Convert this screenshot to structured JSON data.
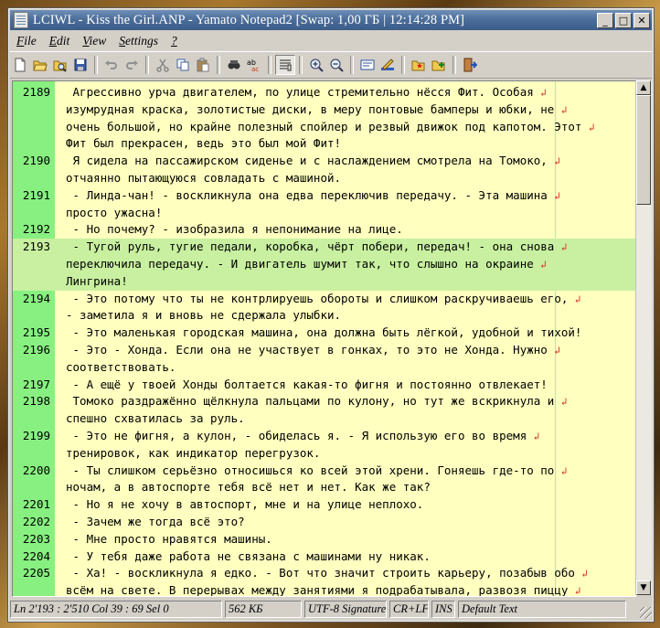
{
  "window": {
    "title": "LCIWL - Kiss the Girl.ANP - Yamato Notepad2 [Swap: 1,00 ГБ | 12:14:28 PM]",
    "buttons": [
      "_",
      "□",
      "✕"
    ]
  },
  "menu": [
    {
      "label": "File",
      "hotkey": "F"
    },
    {
      "label": "Edit",
      "hotkey": "E"
    },
    {
      "label": "View",
      "hotkey": "V"
    },
    {
      "label": "Settings",
      "hotkey": "S"
    },
    {
      "label": "?",
      "hotkey": "?"
    }
  ],
  "toolbar": {
    "icons": [
      "new-icon",
      "open-icon",
      "browse-icon",
      "save-icon",
      "undo-icon",
      "redo-icon",
      "cut-icon",
      "copy-icon",
      "paste-icon",
      "find-icon",
      "replace-icon",
      "word-wrap-icon",
      "zoom-in-icon",
      "zoom-out-icon",
      "scheme-icon",
      "customize-icon",
      "favorites-open-icon",
      "favorites-add-icon",
      "exit-icon"
    ]
  },
  "editor": {
    "colors": {
      "background": "#ffffc0",
      "gutter": "#88f080",
      "highlight": "#c8f0a0",
      "wrap_mark": "#d03020"
    },
    "wrap_mark": "↲",
    "lines": [
      {
        "num": "2189",
        "text": " Агрессивно урча двигателем, по улице стремительно нёсся Фит. Особая",
        "wrap": true
      },
      {
        "num": "",
        "text": "изумрудная краска, золотистые диски, в меру понтовые бамперы и юбки, не",
        "wrap": true
      },
      {
        "num": "",
        "text": "очень большой, но крайне полезный спойлер и резвый движок под капотом. Этот",
        "wrap": true
      },
      {
        "num": "",
        "text": "Фит был прекрасен, ведь это был мой Фит!",
        "wrap": false
      },
      {
        "num": "2190",
        "text": " Я сидела на пассажирском сиденье и с наслаждением смотрела на Томоко,",
        "wrap": true
      },
      {
        "num": "",
        "text": "отчаянно пытающуюся совладать с машиной.",
        "wrap": false
      },
      {
        "num": "2191",
        "text": " - Линда-чан! - воскликнула она едва переключив передачу. - Эта машина",
        "wrap": true
      },
      {
        "num": "",
        "text": "просто ужасна!",
        "wrap": false
      },
      {
        "num": "2192",
        "text": " - Но почему? - изобразила я непонимание на лице.",
        "wrap": false
      },
      {
        "num": "2193",
        "text": " - Тугой руль, тугие педали, коробка, чёрт побери, передач! - она снова",
        "wrap": true,
        "hl": true
      },
      {
        "num": "",
        "text": "переключила передачу. - И двигатель шумит так, что слышно на окраине",
        "wrap": true,
        "hl": true
      },
      {
        "num": "",
        "text": "Лингрина!",
        "wrap": false,
        "hl": true
      },
      {
        "num": "2194",
        "text": " - Это потому что ты не контрлируешь обороты и слишком раскручиваешь его,",
        "wrap": true
      },
      {
        "num": "",
        "text": "- заметила я и вновь не сдержала улыбки.",
        "wrap": false
      },
      {
        "num": "2195",
        "text": " - Это маленькая городская машина, она должна быть лёгкой, удобной и тихой!",
        "wrap": false
      },
      {
        "num": "2196",
        "text": " - Это - Хонда. Если она не участвует в гонках, то это не Хонда. Нужно",
        "wrap": true
      },
      {
        "num": "",
        "text": "соответствовать.",
        "wrap": false
      },
      {
        "num": "2197",
        "text": " - А ещё у твоей Хонды болтается какая-то фигня и постоянно отвлекает!",
        "wrap": false
      },
      {
        "num": "2198",
        "text": " Томоко раздражённо щёлкнула пальцами по кулону, но тут же вскрикнула и",
        "wrap": true
      },
      {
        "num": "",
        "text": "спешно схватилась за руль.",
        "wrap": false
      },
      {
        "num": "2199",
        "text": " - Это не фигня, а кулон, - обиделась я. - Я использую его во время",
        "wrap": true
      },
      {
        "num": "",
        "text": "тренировок, как индикатор перегрузок.",
        "wrap": false
      },
      {
        "num": "2200",
        "text": " - Ты слишком серьёзно относишься ко всей этой хрени. Гоняешь где-то по",
        "wrap": true
      },
      {
        "num": "",
        "text": "ночам, а в автоспорте тебя всё нет и нет. Как же так?",
        "wrap": false
      },
      {
        "num": "2201",
        "text": " - Но я не хочу в автоспорт, мне и на улице неплохо.",
        "wrap": false
      },
      {
        "num": "2202",
        "text": " - Зачем же тогда всё это?",
        "wrap": false
      },
      {
        "num": "2203",
        "text": " - Мне просто нравятся машины.",
        "wrap": false
      },
      {
        "num": "2204",
        "text": " - У тебя даже работа не связана с машинами ну никак.",
        "wrap": false
      },
      {
        "num": "2205",
        "text": " - Ха! - воскликнула я едко. - Вот что значит строить карьеру, позабыв обо",
        "wrap": true
      },
      {
        "num": "",
        "text": "всём на свете. В перерывах между занятиями я подрабатывала, развозя пиццу",
        "wrap": true
      }
    ]
  },
  "status": {
    "position": "Ln 2'193 : 2'510   Col 39 : 69   Sel 0",
    "size": "562 КБ",
    "encoding": "UTF-8 Signature",
    "eol": "CR+LF",
    "mode": "INS",
    "scheme": "Default Text"
  }
}
